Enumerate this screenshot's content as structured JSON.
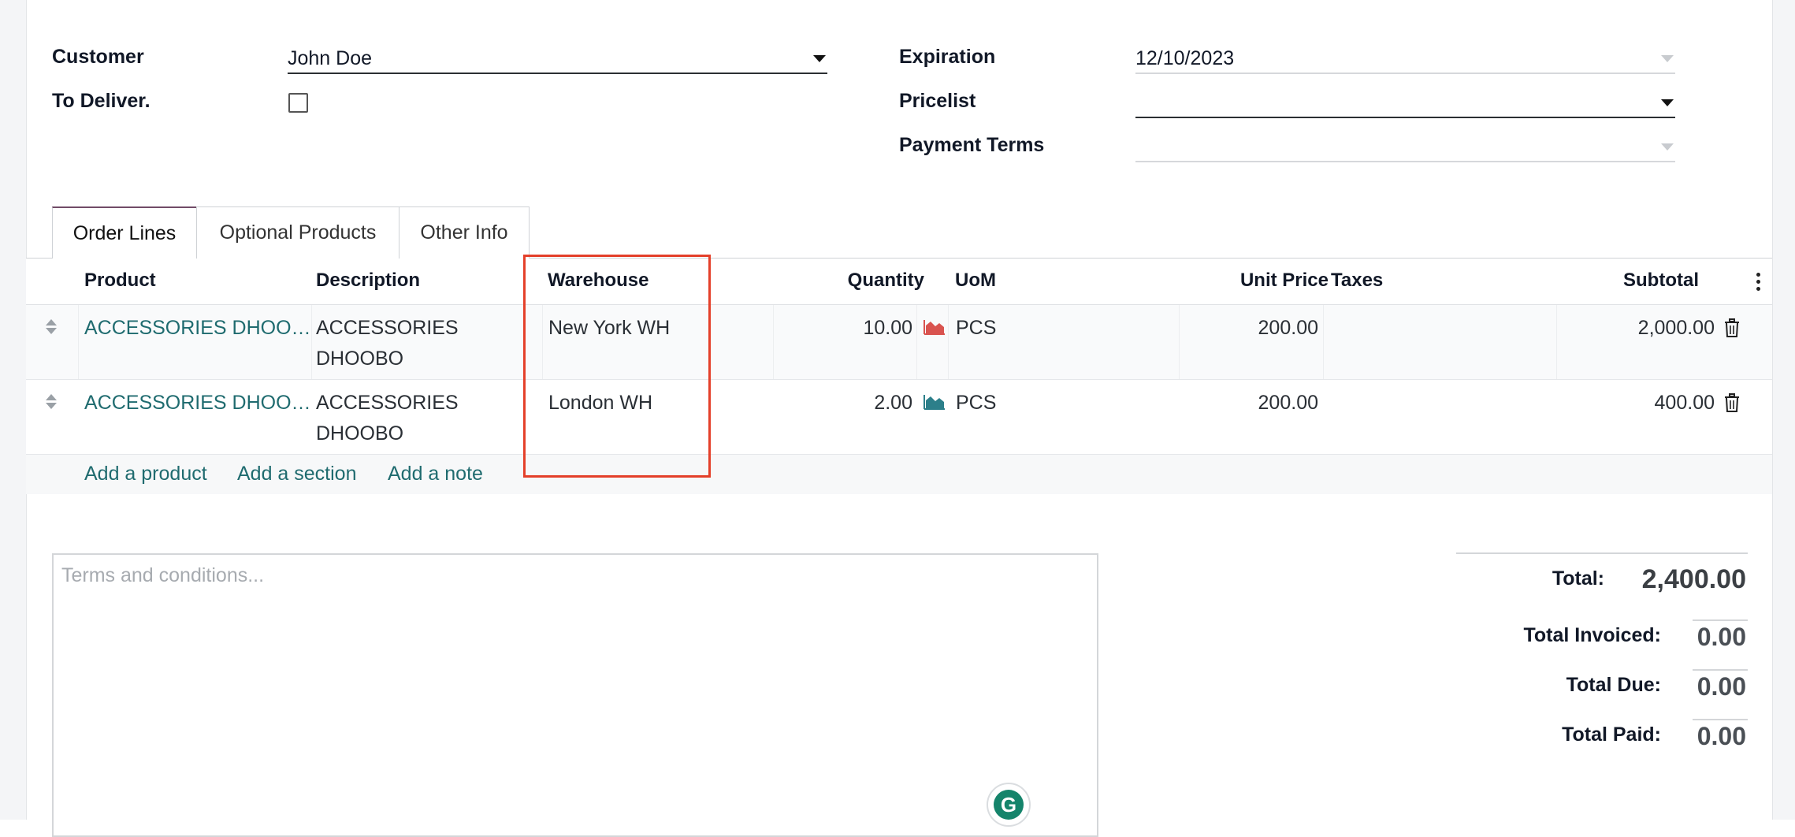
{
  "form": {
    "customer_label": "Customer",
    "customer_value": "John Doe",
    "to_deliver_label": "To Deliver.",
    "expiration_label": "Expiration",
    "expiration_value": "12/10/2023",
    "pricelist_label": "Pricelist",
    "pricelist_value": "",
    "payment_terms_label": "Payment Terms",
    "payment_terms_value": ""
  },
  "tabs": [
    {
      "label": "Order Lines",
      "active": true
    },
    {
      "label": "Optional Products",
      "active": false
    },
    {
      "label": "Other Info",
      "active": false
    }
  ],
  "table": {
    "headers": {
      "product": "Product",
      "description": "Description",
      "warehouse": "Warehouse",
      "quantity": "Quantity",
      "uom": "UoM",
      "unit_price": "Unit Price",
      "taxes": "Taxes",
      "subtotal": "Subtotal"
    },
    "rows": [
      {
        "product": "ACCESSORIES DHOO…",
        "description_line1": "ACCESSORIES",
        "description_line2": "DHOOBO",
        "warehouse": "New York WH",
        "quantity": "10.00",
        "forecast_icon": "forecast-area-chart-icon",
        "forecast_color": "#d9534f",
        "uom": "PCS",
        "unit_price": "200.00",
        "taxes": "",
        "subtotal": "2,000.00"
      },
      {
        "product": "ACCESSORIES DHOO…",
        "description_line1": "ACCESSORIES",
        "description_line2": "DHOOBO",
        "warehouse": "London WH",
        "quantity": "2.00",
        "forecast_icon": "forecast-area-chart-icon",
        "forecast_color": "#2c7f8a",
        "uom": "PCS",
        "unit_price": "200.00",
        "taxes": "",
        "subtotal": "400.00"
      }
    ],
    "add_links": {
      "product": "Add a product",
      "section": "Add a section",
      "note": "Add a note"
    }
  },
  "terms": {
    "placeholder": "Terms and conditions..."
  },
  "totals": {
    "total_label": "Total:",
    "total_value": "2,400.00",
    "invoiced_label": "Total Invoiced:",
    "invoiced_value": "0.00",
    "due_label": "Total Due:",
    "due_value": "0.00",
    "paid_label": "Total Paid:",
    "paid_value": "0.00"
  },
  "colors": {
    "link": "#1f6b6f",
    "active_tab_accent": "#714b67",
    "highlight_box": "#e4402a",
    "grammarly": "#15846b"
  }
}
